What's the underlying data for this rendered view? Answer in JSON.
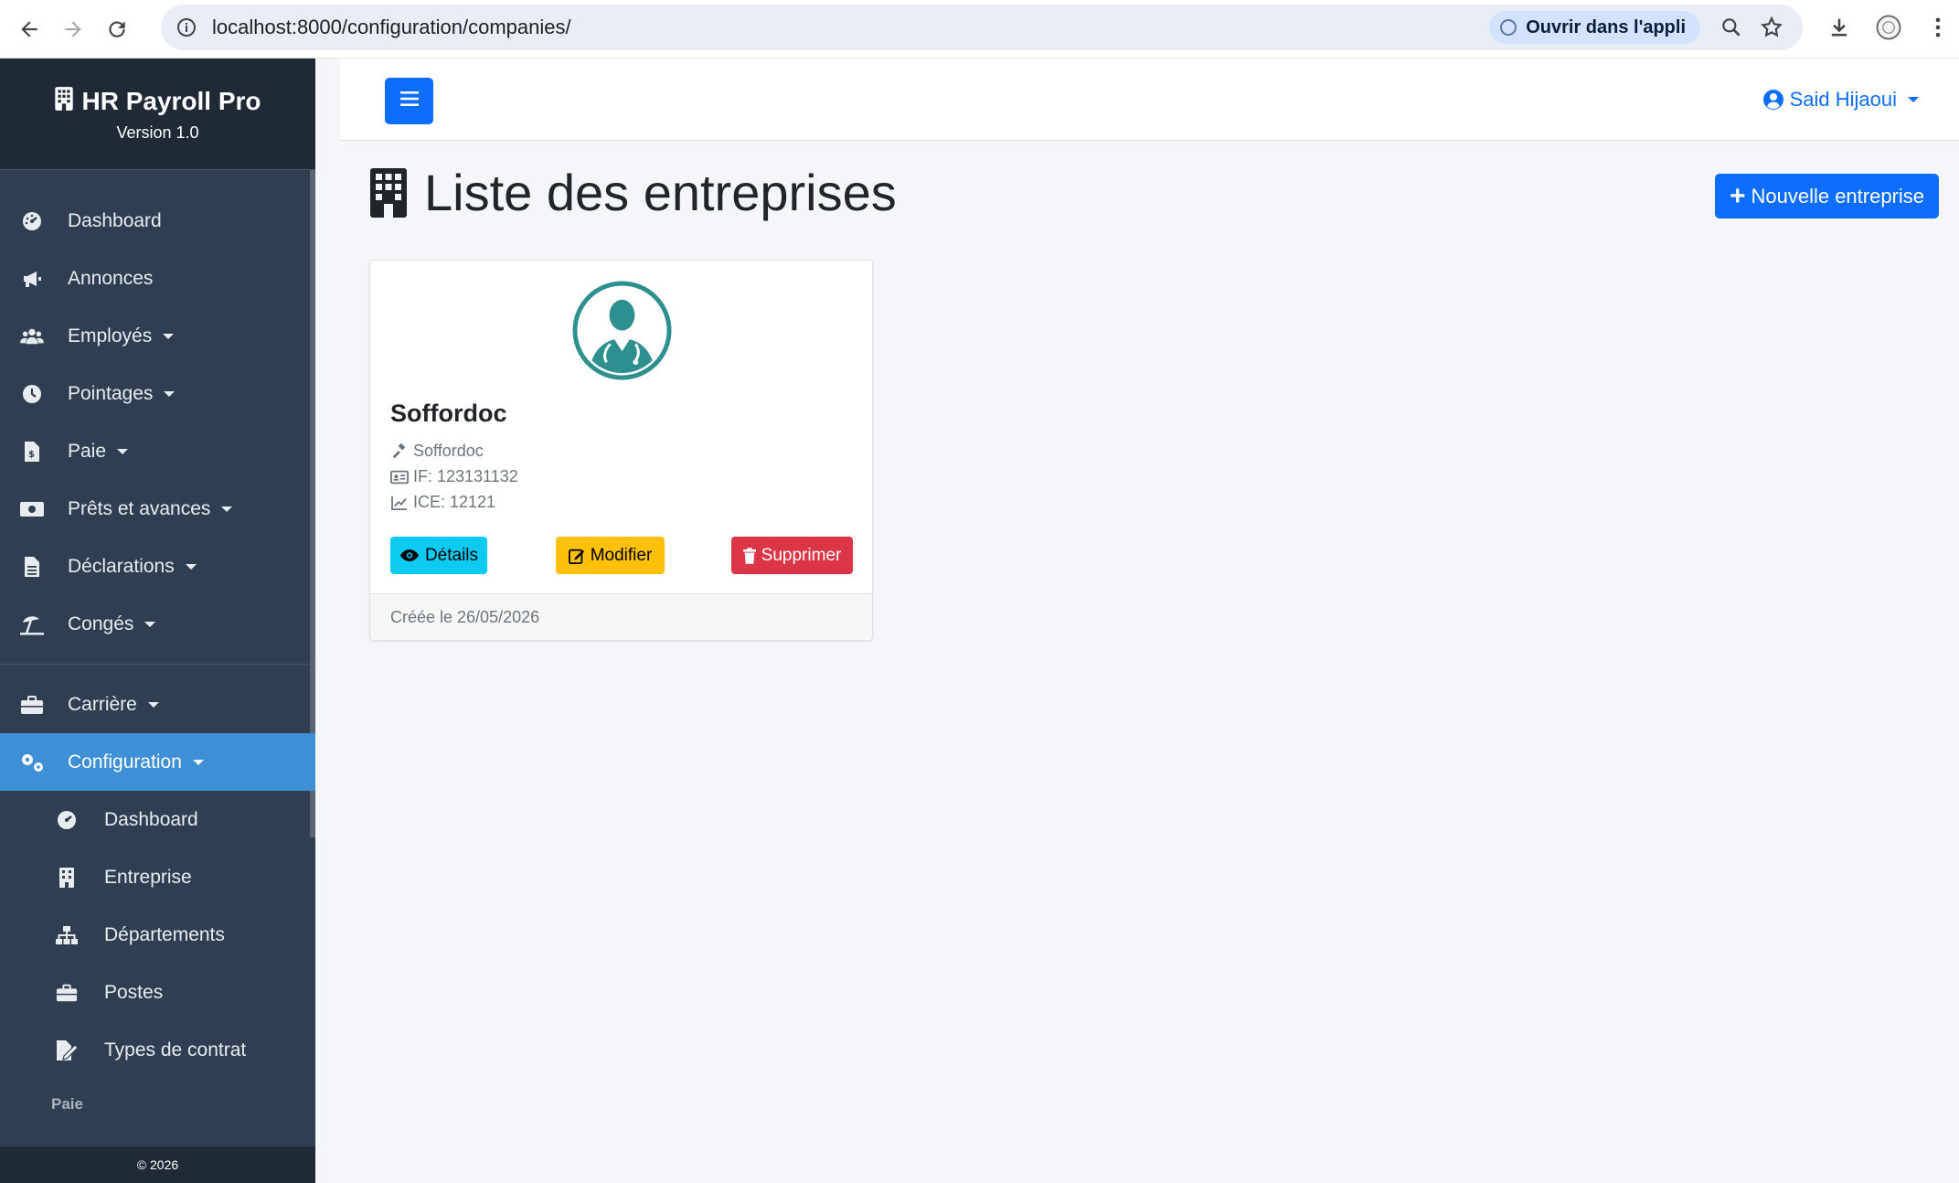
{
  "browser": {
    "url": "localhost:8000/configuration/companies/",
    "open_app_label": "Ouvrir dans l'appli"
  },
  "brand": {
    "title": "HR Payroll Pro",
    "version": "Version 1.0"
  },
  "sidebar": {
    "items": [
      {
        "label": "Dashboard",
        "icon": "gauge-icon"
      },
      {
        "label": "Annonces",
        "icon": "megaphone-icon"
      },
      {
        "label": "Employés",
        "icon": "users-icon"
      },
      {
        "label": "Pointages",
        "icon": "clock-icon"
      },
      {
        "label": "Paie",
        "icon": "invoice-dollar-icon"
      },
      {
        "label": "Prêts et avances",
        "icon": "money-bill-icon"
      },
      {
        "label": "Déclarations",
        "icon": "file-alt-icon"
      },
      {
        "label": "Congés",
        "icon": "umbrella-beach-icon"
      },
      {
        "label": "Carrière",
        "icon": "briefcase-icon"
      },
      {
        "label": "Configuration",
        "icon": "cogs-icon"
      }
    ],
    "sub_items": [
      {
        "label": "Dashboard",
        "icon": "gauge-icon"
      },
      {
        "label": "Entreprise",
        "icon": "building-icon"
      },
      {
        "label": "Départements",
        "icon": "sitemap-icon"
      },
      {
        "label": "Postes",
        "icon": "briefcase-icon"
      },
      {
        "label": "Types de contrat",
        "icon": "file-signature-icon"
      }
    ],
    "section_label": "Paie",
    "footer": "© 2026"
  },
  "topnav": {
    "user_name": "Said Hijaoui"
  },
  "main": {
    "title": "Liste des entreprises",
    "new_button": "Nouvelle entreprise",
    "company": {
      "name": "Soffordoc",
      "legal_name": "Soffordoc",
      "if_text": "IF: 123131132",
      "ice_text": "ICE: 12121",
      "details_label": "Détails",
      "edit_label": "Modifier",
      "delete_label": "Supprimer",
      "created_text": "Créée le 26/05/2026"
    }
  },
  "colors": {
    "primary": "#0d6efd",
    "sidebar_bg": "#2f3f51",
    "active_item": "#3d8fd6",
    "info": "#0dcaf0",
    "warning": "#ffc107",
    "danger": "#dc3545",
    "avatar": "#2e8f8f"
  }
}
